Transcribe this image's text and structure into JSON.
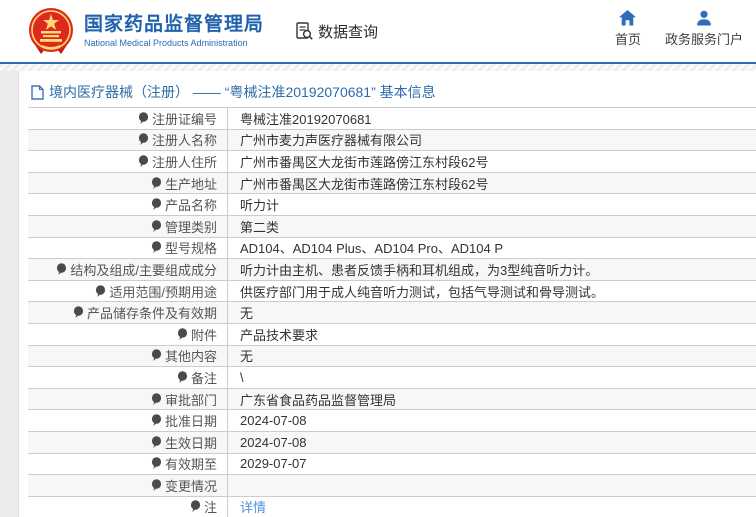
{
  "header": {
    "logo": {
      "title_cn": "国家药品监督管理局",
      "title_en": "National Medical Products Administration"
    },
    "data_query_label": "数据查询",
    "nav_links": [
      {
        "label": "首页",
        "icon": "home-icon"
      },
      {
        "label": "政务服务门户",
        "icon": "user-icon"
      }
    ]
  },
  "breadcrumb": {
    "icon": "document-icon",
    "text": "境内医疗器械（注册） —— “粤械注准20192070681” 基本信息"
  },
  "colors": {
    "brand_blue": "#2062ac",
    "line_blue": "#2e6cb5",
    "breadcrumb_blue": "#2f6bab",
    "link_blue": "#4e94e2",
    "emblem_red": "#de2a1e",
    "emblem_gold": "#ffd978"
  },
  "table": {
    "rows": [
      {
        "label": "注册证编号",
        "value": "粤械注准20192070681"
      },
      {
        "label": "注册人名称",
        "value": "广州市麦力声医疗器械有限公司"
      },
      {
        "label": "注册人住所",
        "value": "广州市番禺区大龙街市莲路傍江东村段62号"
      },
      {
        "label": "生产地址",
        "value": "广州市番禺区大龙街市莲路傍江东村段62号"
      },
      {
        "label": "产品名称",
        "value": "听力计"
      },
      {
        "label": "管理类别",
        "value": "第二类"
      },
      {
        "label": "型号规格",
        "value": "AD104、AD104 Plus、AD104 Pro、AD104 P"
      },
      {
        "label": "结构及组成/主要组成成分",
        "value": "听力计由主机、患者反馈手柄和耳机组成，为3型纯音听力计。"
      },
      {
        "label": "适用范围/预期用途",
        "value": "供医疗部门用于成人纯音听力测试，包括气导测试和骨导测试。"
      },
      {
        "label": "产品储存条件及有效期",
        "value": "无"
      },
      {
        "label": "附件",
        "value": "产品技术要求"
      },
      {
        "label": "其他内容",
        "value": "无"
      },
      {
        "label": "备注",
        "value": "\\"
      },
      {
        "label": "审批部门",
        "value": "广东省食品药品监督管理局"
      },
      {
        "label": "批准日期",
        "value": "2024-07-08"
      },
      {
        "label": "生效日期",
        "value": "2024-07-08"
      },
      {
        "label": "有效期至",
        "value": "2029-07-07"
      },
      {
        "label": "变更情况",
        "value": ""
      },
      {
        "label": "注",
        "value": "详情",
        "link": true,
        "icon": "balloon-icon"
      }
    ]
  }
}
